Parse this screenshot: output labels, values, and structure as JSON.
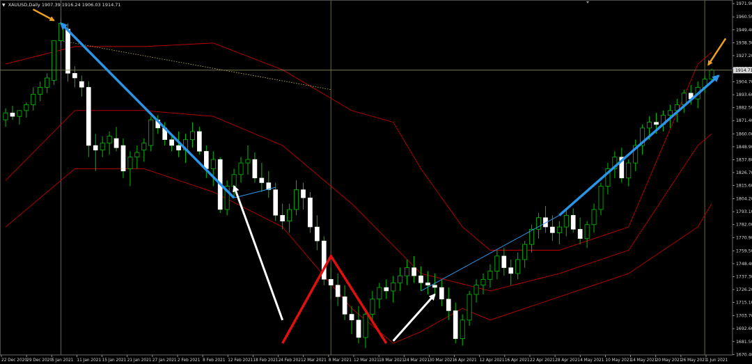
{
  "header": {
    "symbol": "XAUUSD,Daily",
    "ohlc": "1907.39 1916.24 1906.03 1914.71"
  },
  "colors": {
    "background": "#000000",
    "bull_candle": "#ffffff",
    "bear_candle": "#ffffff",
    "wick_bull": "#00c000",
    "bollinger": "#c00000",
    "trend_blue": "#2a94e6",
    "zigzag_red": "#e01010",
    "zigzag_white": "#ffffff",
    "arrow_orange": "#f0a020",
    "vline": "#6b6b2e",
    "price_line": "#8a8a5a",
    "dotted": "#c8c060"
  },
  "chart_data": {
    "type": "candlestick",
    "symbol": "XAUUSD",
    "timeframe": "Daily",
    "current_price": "1914.71",
    "ylim": [
      1670.0,
      1975.0
    ],
    "y_ticks": [
      "1971.90",
      "1960.50",
      "1949.40",
      "1938.30",
      "1927.20",
      "1916.00",
      "1904.70",
      "1893.60",
      "1882.50",
      "1871.40",
      "1860.00",
      "1848.90",
      "1837.80",
      "1826.70",
      "1815.60",
      "1804.20",
      "1793.10",
      "1782.00",
      "1770.90",
      "1759.50",
      "1748.40",
      "1737.30",
      "1726.20",
      "1715.10",
      "1703.70",
      "1692.60",
      "1681.50",
      "1670.40"
    ],
    "x_labels": [
      "22 Dec 2020",
      "29 Dec 2020",
      "5 Jan 2021",
      "11 Jan 2021",
      "15 Jan 2021",
      "21 Jan 2021",
      "27 Jan 2021",
      "2 Feb 2021",
      "8 Feb 2021",
      "12 Feb 2021",
      "18 Feb 2021",
      "24 Feb 2021",
      "2 Mar 2021",
      "8 Mar 2021",
      "12 Mar 2021",
      "18 Mar 2021",
      "24 Mar 2021",
      "30 Mar 2021",
      "6 Apr 2021",
      "12 Apr 2021",
      "16 Apr 2021",
      "22 Apr 2021",
      "28 Apr 2021",
      "4 May 2021",
      "10 May 2021",
      "14 May 2021",
      "20 May 2021",
      "26 May 2021",
      "1 Jun 2021"
    ],
    "candles": [
      [
        1872,
        1882,
        1866,
        1878
      ],
      [
        1878,
        1884,
        1872,
        1875
      ],
      [
        1875,
        1880,
        1868,
        1880
      ],
      [
        1880,
        1887,
        1874,
        1885
      ],
      [
        1885,
        1900,
        1880,
        1894
      ],
      [
        1894,
        1905,
        1888,
        1900
      ],
      [
        1900,
        1912,
        1895,
        1908
      ],
      [
        1906,
        1940,
        1902,
        1940
      ],
      [
        1940,
        1960,
        1935,
        1955
      ],
      [
        1950,
        1955,
        1905,
        1912
      ],
      [
        1912,
        1918,
        1900,
        1908
      ],
      [
        1905,
        1910,
        1892,
        1900
      ],
      [
        1900,
        1905,
        1840,
        1850
      ],
      [
        1850,
        1860,
        1828,
        1846
      ],
      [
        1846,
        1858,
        1840,
        1852
      ],
      [
        1852,
        1862,
        1842,
        1858
      ],
      [
        1856,
        1866,
        1845,
        1848
      ],
      [
        1850,
        1856,
        1822,
        1828
      ],
      [
        1830,
        1845,
        1815,
        1840
      ],
      [
        1840,
        1850,
        1830,
        1844
      ],
      [
        1846,
        1856,
        1836,
        1852
      ],
      [
        1850,
        1875,
        1845,
        1872
      ],
      [
        1872,
        1876,
        1860,
        1865
      ],
      [
        1865,
        1870,
        1850,
        1855
      ],
      [
        1855,
        1860,
        1845,
        1850
      ],
      [
        1850,
        1862,
        1840,
        1846
      ],
      [
        1846,
        1860,
        1835,
        1855
      ],
      [
        1855,
        1870,
        1848,
        1862
      ],
      [
        1862,
        1866,
        1842,
        1845
      ],
      [
        1845,
        1850,
        1822,
        1830
      ],
      [
        1830,
        1845,
        1815,
        1838
      ],
      [
        1838,
        1840,
        1792,
        1795
      ],
      [
        1795,
        1820,
        1790,
        1815
      ],
      [
        1815,
        1830,
        1805,
        1825
      ],
      [
        1825,
        1840,
        1818,
        1835
      ],
      [
        1835,
        1850,
        1825,
        1838
      ],
      [
        1838,
        1844,
        1818,
        1822
      ],
      [
        1822,
        1835,
        1810,
        1818
      ],
      [
        1818,
        1828,
        1805,
        1812
      ],
      [
        1812,
        1818,
        1785,
        1790
      ],
      [
        1790,
        1800,
        1778,
        1785
      ],
      [
        1785,
        1800,
        1775,
        1795
      ],
      [
        1795,
        1820,
        1790,
        1812
      ],
      [
        1812,
        1818,
        1795,
        1805
      ],
      [
        1805,
        1810,
        1775,
        1780
      ],
      [
        1780,
        1790,
        1760,
        1768
      ],
      [
        1768,
        1772,
        1730,
        1735
      ],
      [
        1735,
        1745,
        1718,
        1730
      ],
      [
        1730,
        1740,
        1712,
        1720
      ],
      [
        1720,
        1730,
        1700,
        1705
      ],
      [
        1705,
        1712,
        1688,
        1700
      ],
      [
        1700,
        1712,
        1680,
        1685
      ],
      [
        1685,
        1710,
        1676,
        1705
      ],
      [
        1705,
        1725,
        1698,
        1718
      ],
      [
        1718,
        1732,
        1710,
        1728
      ],
      [
        1728,
        1735,
        1718,
        1725
      ],
      [
        1725,
        1738,
        1715,
        1732
      ],
      [
        1732,
        1745,
        1725,
        1738
      ],
      [
        1738,
        1752,
        1730,
        1745
      ],
      [
        1745,
        1755,
        1732,
        1738
      ],
      [
        1738,
        1746,
        1725,
        1732
      ],
      [
        1732,
        1742,
        1722,
        1730
      ],
      [
        1730,
        1740,
        1720,
        1728
      ],
      [
        1728,
        1735,
        1712,
        1718
      ],
      [
        1718,
        1728,
        1700,
        1708
      ],
      [
        1708,
        1715,
        1680,
        1684
      ],
      [
        1684,
        1705,
        1678,
        1700
      ],
      [
        1700,
        1725,
        1695,
        1722
      ],
      [
        1722,
        1735,
        1715,
        1730
      ],
      [
        1730,
        1740,
        1722,
        1735
      ],
      [
        1735,
        1748,
        1728,
        1742
      ],
      [
        1742,
        1760,
        1735,
        1755
      ],
      [
        1755,
        1762,
        1738,
        1745
      ],
      [
        1745,
        1752,
        1730,
        1740
      ],
      [
        1740,
        1758,
        1735,
        1752
      ],
      [
        1752,
        1768,
        1745,
        1765
      ],
      [
        1765,
        1782,
        1758,
        1778
      ],
      [
        1778,
        1792,
        1770,
        1788
      ],
      [
        1788,
        1798,
        1775,
        1780
      ],
      [
        1780,
        1790,
        1768,
        1775
      ],
      [
        1775,
        1785,
        1765,
        1780
      ],
      [
        1780,
        1795,
        1772,
        1790
      ],
      [
        1790,
        1796,
        1775,
        1778
      ],
      [
        1778,
        1788,
        1765,
        1770
      ],
      [
        1770,
        1785,
        1762,
        1782
      ],
      [
        1782,
        1800,
        1775,
        1795
      ],
      [
        1795,
        1818,
        1790,
        1815
      ],
      [
        1815,
        1835,
        1808,
        1830
      ],
      [
        1830,
        1845,
        1822,
        1840
      ],
      [
        1840,
        1848,
        1818,
        1822
      ],
      [
        1822,
        1838,
        1815,
        1835
      ],
      [
        1835,
        1855,
        1828,
        1850
      ],
      [
        1850,
        1868,
        1842,
        1865
      ],
      [
        1865,
        1875,
        1855,
        1870
      ],
      [
        1870,
        1878,
        1860,
        1868
      ],
      [
        1868,
        1880,
        1862,
        1876
      ],
      [
        1876,
        1885,
        1865,
        1880
      ],
      [
        1880,
        1890,
        1870,
        1885
      ],
      [
        1885,
        1898,
        1878,
        1895
      ],
      [
        1895,
        1902,
        1885,
        1890
      ],
      [
        1890,
        1905,
        1882,
        1900
      ],
      [
        1900,
        1910,
        1895,
        1907
      ],
      [
        1907,
        1916,
        1906,
        1914.71
      ]
    ],
    "bollinger": {
      "upper_x": [
        0,
        10,
        20,
        30,
        40,
        50,
        56,
        60,
        66,
        70,
        80,
        90,
        100,
        102
      ],
      "upper_y": [
        1920,
        1935,
        1935,
        1938,
        1915,
        1880,
        1870,
        1830,
        1780,
        1760,
        1760,
        1780,
        1920,
        1930
      ],
      "middle_x": [
        0,
        10,
        20,
        30,
        40,
        50,
        60,
        70,
        80,
        90,
        100,
        102
      ],
      "middle_y": [
        1820,
        1880,
        1880,
        1875,
        1850,
        1800,
        1740,
        1725,
        1740,
        1760,
        1850,
        1860
      ],
      "lower_x": [
        0,
        10,
        20,
        30,
        40,
        50,
        56,
        60,
        66,
        70,
        80,
        90,
        100,
        102
      ],
      "lower_y": [
        1780,
        1830,
        1830,
        1810,
        1780,
        1710,
        1680,
        1690,
        1710,
        1700,
        1720,
        1740,
        1780,
        1800
      ]
    },
    "overlays": {
      "blue_trend_1": [
        [
          8,
          1955
        ],
        [
          33,
          1805
        ]
      ],
      "blue_trend_2": [
        [
          60,
          1725
        ],
        [
          103,
          1910
        ]
      ],
      "red_zigzag": [
        [
          40,
          1680
        ],
        [
          47,
          1755
        ],
        [
          55,
          1680
        ]
      ],
      "white_zigzag_1": [
        [
          33,
          1815
        ],
        [
          40,
          1700
        ]
      ],
      "white_zigzag_2": [
        [
          56,
          1682
        ],
        [
          62,
          1722
        ]
      ],
      "orange_arrow_1_target": [
        8,
        1955
      ],
      "orange_arrow_2_target": [
        101,
        1912
      ]
    },
    "legend_position": "none",
    "grid": false
  }
}
